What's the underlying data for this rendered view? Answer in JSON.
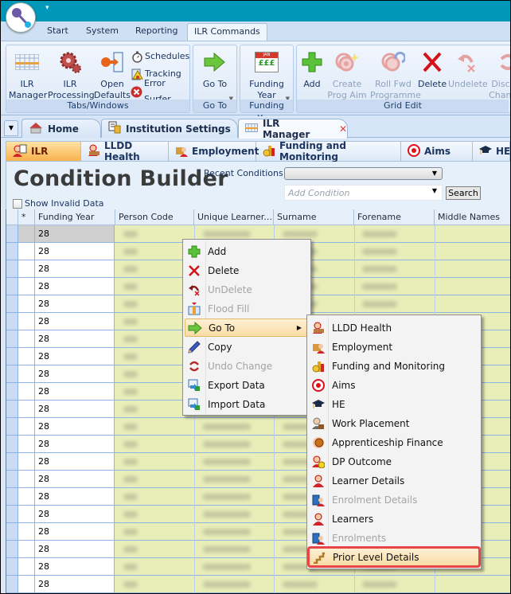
{
  "window": {
    "title_bar_color": "#0197b9"
  },
  "quick_access": {
    "dropdown_glyph": "▾"
  },
  "ribbon": {
    "tabs": [
      {
        "label": "Start",
        "active": false
      },
      {
        "label": "System",
        "active": false
      },
      {
        "label": "Reporting",
        "active": false
      },
      {
        "label": "ILR Commands",
        "active": true
      }
    ],
    "groups": {
      "tabs_windows": {
        "label": "Tabs/Windows",
        "buttons": [
          {
            "label_line1": "ILR",
            "label_line2": "Manager",
            "icon": "grid-icon"
          },
          {
            "label_line1": "ILR",
            "label_line2": "Processing",
            "icon": "gear-icon"
          },
          {
            "label_line1": "Open",
            "label_line2": "Defaults",
            "icon": "open-defaults-icon"
          }
        ],
        "small_buttons": [
          {
            "label": "Schedules",
            "icon": "stopwatch-icon"
          },
          {
            "label": "Tracking",
            "icon": "tracking-icon"
          },
          {
            "label": "Error Surfer",
            "icon": "error-icon"
          }
        ]
      },
      "go_to": {
        "label": "Go To",
        "button": {
          "label": "Go To",
          "icon": "arrow-right-icon"
        }
      },
      "funding_year": {
        "label": "Funding Year",
        "button": {
          "label_line1": "Funding",
          "label_line2": "Year",
          "icon": "calendar-icon",
          "calendar_text": "JAN",
          "calendar_value": "£££"
        }
      },
      "grid_edit": {
        "label": "Grid Edit",
        "buttons": [
          {
            "label_line1": "Add",
            "label_line2": "",
            "disabled": false,
            "icon": "plus-icon"
          },
          {
            "label_line1": "Create",
            "label_line2": "Prog Aim",
            "disabled": true,
            "icon": "create-prog-aim-icon"
          },
          {
            "label_line1": "Roll Fwd",
            "label_line2": "Programme",
            "disabled": true,
            "icon": "roll-forward-icon"
          },
          {
            "label_line1": "Delete",
            "label_line2": "",
            "disabled": false,
            "icon": "delete-icon"
          },
          {
            "label_line1": "Undelete",
            "label_line2": "",
            "disabled": true,
            "icon": "undelete-icon"
          },
          {
            "label_line1": "Discard",
            "label_line2": "Changes",
            "disabled": true,
            "icon": "discard-icon"
          }
        ]
      }
    }
  },
  "doc_tabs": [
    {
      "label": "Home",
      "icon": "home-icon",
      "active": false
    },
    {
      "label": "Institution Settings",
      "icon": "institution-icon",
      "active": false
    },
    {
      "label": "ILR Manager",
      "icon": "grid-icon",
      "active": true,
      "closable": true
    }
  ],
  "sub_tabs": [
    {
      "label": "ILR",
      "active": true
    },
    {
      "label": "LLDD Health",
      "active": false
    },
    {
      "label": "Employment",
      "active": false
    },
    {
      "label": "Funding and Monitoring",
      "active": false
    },
    {
      "label": "Aims",
      "active": false
    },
    {
      "label": "HE",
      "active": false
    }
  ],
  "condition_builder": {
    "title": "Condition Builder",
    "recent_conditions_label": "Recent Conditions",
    "recent_conditions_value": "",
    "add_condition_placeholder": "Add Condition",
    "search_label": "Search",
    "show_invalid_label": "Show Invalid Data",
    "show_invalid_checked": false
  },
  "grid": {
    "columns": [
      "*",
      "Funding Year",
      "Person Code",
      "Unique Learner...",
      "Surname",
      "Forename",
      "Middle Names"
    ],
    "rows": [
      "28",
      "28",
      "28",
      "28",
      "28",
      "28",
      "28",
      "28",
      "28",
      "28",
      "28",
      "28",
      "28",
      "28",
      "28",
      "28",
      "28",
      "28",
      "28",
      "28",
      "28"
    ]
  },
  "context_menu": {
    "items": [
      {
        "label": "Add",
        "icon": "plus-icon",
        "disabled": false
      },
      {
        "label": "Delete",
        "icon": "delete-icon",
        "disabled": false
      },
      {
        "label": "UnDelete",
        "icon": "undelete-icon",
        "disabled": true
      },
      {
        "label": "Flood Fill",
        "icon": "flood-fill-icon",
        "disabled": true
      },
      {
        "label": "Go To",
        "icon": "arrow-right-icon",
        "disabled": false,
        "submenu": true,
        "hover": true
      },
      {
        "label": "Copy",
        "icon": "pencil-icon",
        "disabled": false
      },
      {
        "label": "Undo Change",
        "icon": "undo-change-icon",
        "disabled": true
      },
      {
        "label": "Export Data",
        "icon": "export-data-icon",
        "disabled": false
      },
      {
        "label": "Import Data",
        "icon": "import-data-icon",
        "disabled": false
      }
    ]
  },
  "goto_submenu": {
    "items": [
      {
        "label": "LLDD Health",
        "icon": "lldd-health-icon",
        "disabled": false
      },
      {
        "label": "Employment",
        "icon": "employment-icon",
        "disabled": false
      },
      {
        "label": "Funding and Monitoring",
        "icon": "funding-icon",
        "disabled": false
      },
      {
        "label": "Aims",
        "icon": "target-icon",
        "disabled": false
      },
      {
        "label": "HE",
        "icon": "graduation-cap-icon",
        "disabled": false
      },
      {
        "label": "Work Placement",
        "icon": "work-placement-icon",
        "disabled": false
      },
      {
        "label": "Apprenticeship Finance",
        "icon": "apprenticeship-finance-icon",
        "disabled": false
      },
      {
        "label": "DP Outcome",
        "icon": "dp-outcome-icon",
        "disabled": false
      },
      {
        "label": "Learner Details",
        "icon": "learner-icon",
        "disabled": false
      },
      {
        "label": "Enrolment Details",
        "icon": "enrolment-icon",
        "disabled": true
      },
      {
        "label": "Learners",
        "icon": "learner-icon",
        "disabled": false
      },
      {
        "label": "Enrolments",
        "icon": "enrolment-icon",
        "disabled": true
      },
      {
        "label": "Prior Level Details",
        "icon": "stairs-icon",
        "disabled": false,
        "highlighted": true
      }
    ]
  },
  "colors": {
    "accent_teal": "#0197b9",
    "active_subtab": "#f8b24d",
    "highlight_outline": "#e84646",
    "grid_fill": "#e9edb8"
  }
}
